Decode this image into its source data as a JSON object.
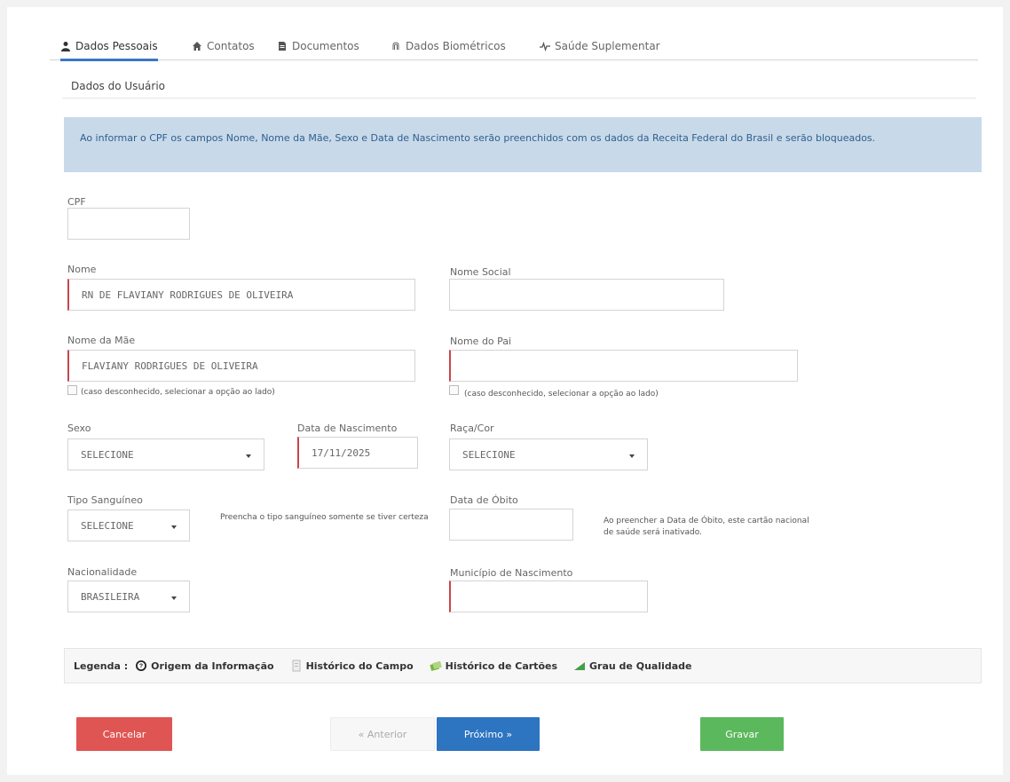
{
  "tabs": [
    {
      "label": "Dados Pessoais",
      "icon": "user-icon",
      "active": true
    },
    {
      "label": "Contatos",
      "icon": "home-icon",
      "active": false
    },
    {
      "label": "Documentos",
      "icon": "document-icon",
      "active": false
    },
    {
      "label": "Dados Biométricos",
      "icon": "fingerprint-icon",
      "active": false
    },
    {
      "label": "Saúde Suplementar",
      "icon": "heartbeat-icon",
      "active": false
    }
  ],
  "section_title": "Dados do Usuário",
  "alert_text": "Ao informar o CPF os campos Nome, Nome da Mãe, Sexo e Data de Nascimento serão preenchidos com os dados da Receita Federal do Brasil e serão bloqueados.",
  "form": {
    "cpf": {
      "label": "CPF",
      "value": ""
    },
    "nome": {
      "label": "Nome",
      "value": "RN DE FLAVIANY RODRIGUES DE OLIVEIRA"
    },
    "nome_social": {
      "label": "Nome Social",
      "value": ""
    },
    "nome_mae": {
      "label": "Nome da Mãe",
      "value": "FLAVIANY RODRIGUES DE OLIVEIRA"
    },
    "nome_pai": {
      "label": "Nome do Pai",
      "value": ""
    },
    "unknown_mae": "(caso desconhecido, selecionar a opção ao lado)",
    "unknown_pai": "(caso desconhecido, selecionar a opção ao lado)",
    "sexo": {
      "label": "Sexo",
      "value": "SELECIONE"
    },
    "data_nascimento": {
      "label": "Data de Nascimento",
      "value": "17/11/2025"
    },
    "raca_cor": {
      "label": "Raça/Cor",
      "value": "SELECIONE"
    },
    "tipo_sanguineo": {
      "label": "Tipo Sanguíneo",
      "value": "SELECIONE"
    },
    "tipo_hint": "Preencha o tipo sanguíneo somente se tiver certeza",
    "data_obito": {
      "label": "Data de Óbito",
      "value": ""
    },
    "obito_hint": "Ao preencher a Data de Óbito, este cartão nacional de saúde será inativado.",
    "nacionalidade": {
      "label": "Nacionalidade",
      "value": "BRASILEIRA"
    },
    "municipio": {
      "label": "Município de Nascimento",
      "value": ""
    }
  },
  "legend": {
    "prefix": "Legenda :",
    "items": [
      {
        "label": "Origem da Informação",
        "icon": "question-circle-icon"
      },
      {
        "label": "Histórico do Campo",
        "icon": "file-history-icon"
      },
      {
        "label": "Histórico de Cartões",
        "icon": "cards-history-icon"
      },
      {
        "label": "Grau de Qualidade",
        "icon": "quality-bar-icon"
      }
    ]
  },
  "buttons": {
    "cancelar": "Cancelar",
    "anterior": "« Anterior",
    "proximo": "Próximo »",
    "gravar": "Gravar"
  },
  "colors": {
    "primary": "#2d74c1",
    "danger": "#df5553",
    "success": "#5cb85c",
    "alert_bg": "#c8d9ea",
    "required_border": "#c9464a"
  }
}
